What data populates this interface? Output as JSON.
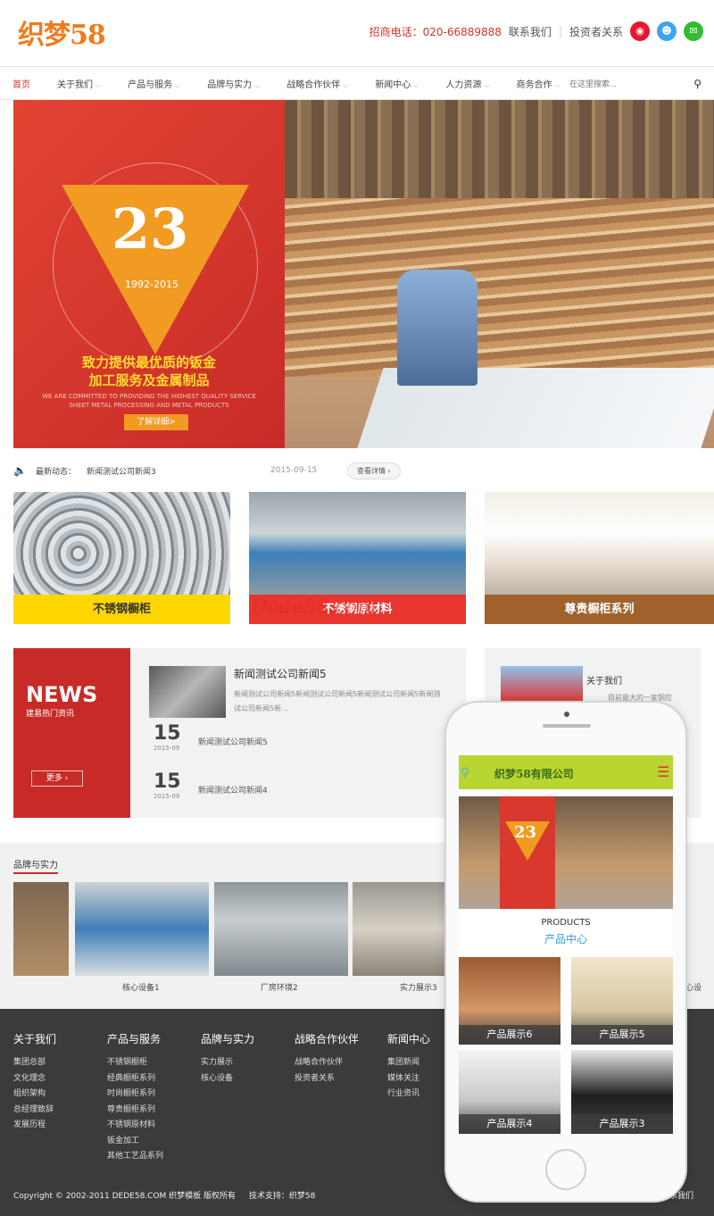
{
  "header": {
    "logo": "织梦58",
    "tel_label": "招商电话：020-66889888",
    "contact_link": "联系我们",
    "separator": "|",
    "investor_link": "投资者关系",
    "social": [
      "weibo-icon",
      "qq-icon",
      "wechat-icon"
    ],
    "social_colors": [
      "#e6162d",
      "#3ea4f2",
      "#2fbe2f"
    ]
  },
  "nav": {
    "items": [
      "首页",
      "关于我们",
      "产品与服务",
      "品牌与实力",
      "战略合作伙伴",
      "新闻中心",
      "人力资源",
      "商务合作"
    ],
    "search_placeholder": "在这里搜索..."
  },
  "banner": {
    "number": "23",
    "years": "1992-2015",
    "title_line1": "致力提供最优质的钣金",
    "title_line2": "加工服务及金属制品",
    "en_line1": "WE ARE COMMITTED TO PROVIDING THE HIGHEST QUALITY SERVICE",
    "en_line2": "SHEET METAL PROCESSING AND METAL PRODUCTS",
    "button": "了解详细>"
  },
  "ticker": {
    "label": "最新动态：",
    "title": "新闻测试公司新闻3",
    "date": "2015-09-15",
    "button": "查看详情"
  },
  "products": [
    {
      "label": "不锈钢橱柜",
      "color": "#ffd600",
      "text": "#333"
    },
    {
      "label": "不锈钢原材料",
      "color": "#e8352e",
      "text": "#fff"
    },
    {
      "label": "尊贵橱柜系列",
      "color": "#a0622d",
      "text": "#fff"
    }
  ],
  "watermark": "Dede58.com",
  "news": {
    "title": "NEWS",
    "subtitle": "建易热门资讯",
    "more": "更多",
    "featured_title": "新闻测试公司新闻5",
    "featured_desc": "新闻测试公司新闻5新闻测试公司新闻5新闻测试公司新闻5新闻测试公司新闻5新...",
    "items": [
      {
        "day": "15",
        "month": "2015-09",
        "title": "新闻测试公司新闻5"
      },
      {
        "day": "15",
        "month": "2015-09",
        "title": "新闻测试公司新闻4"
      }
    ]
  },
  "about": {
    "title": "关于我们",
    "desc": "目前最大的一家钢应"
  },
  "brand": {
    "heading": "品牌与实力",
    "captions": [
      "",
      "核心设备1",
      "厂房环境2",
      "实力展示3",
      "心设"
    ]
  },
  "footer": {
    "columns": [
      {
        "title": "关于我们",
        "links": [
          "集团总部",
          "文化理念",
          "组织架构",
          "总经理致辞",
          "发展历程"
        ]
      },
      {
        "title": "产品与服务",
        "links": [
          "不锈钢橱柜",
          "经典橱柜系列",
          "时尚橱柜系列",
          "尊贵橱柜系列",
          "不锈钢原材料",
          "钣金加工",
          "其他工艺品系列"
        ]
      },
      {
        "title": "品牌与实力",
        "links": [
          "实力展示",
          "核心设备"
        ]
      },
      {
        "title": "战略合作伙伴",
        "links": [
          "战略合作伙伴",
          "投资者关系"
        ]
      },
      {
        "title": "新闻中心",
        "links": [
          "集团新闻",
          "媒体关注",
          "行业资讯"
        ]
      }
    ],
    "copyright": "Copyright © 2002-2011 DEDE58.COM 织梦模板 版权所有",
    "support": "技术支持：织梦58",
    "contact": "联系我们"
  },
  "phone": {
    "company": "织梦58有限公司",
    "banner_num": "23",
    "products_en": "PRODUCTS",
    "products_cn": "产品中心",
    "tiles": [
      "产品展示6",
      "产品展示5",
      "产品展示4",
      "产品展示3"
    ]
  }
}
